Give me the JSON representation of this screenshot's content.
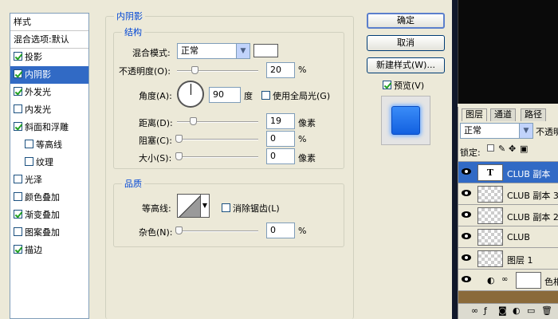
{
  "style_list": {
    "header": "样式",
    "items": [
      {
        "label": "混合选项:默认",
        "type": "plain"
      },
      {
        "label": "投影",
        "checked": true
      },
      {
        "label": "内阴影",
        "checked": true,
        "selected": true
      },
      {
        "label": "外发光",
        "checked": true
      },
      {
        "label": "内发光",
        "checked": false
      },
      {
        "label": "斜面和浮雕",
        "checked": true
      },
      {
        "label": "等高线",
        "checked": false,
        "sub": true
      },
      {
        "label": "纹理",
        "checked": false,
        "sub": true
      },
      {
        "label": "光泽",
        "checked": false
      },
      {
        "label": "颜色叠加",
        "checked": false
      },
      {
        "label": "渐变叠加",
        "checked": true
      },
      {
        "label": "图案叠加",
        "checked": false
      },
      {
        "label": "描边",
        "checked": true
      }
    ]
  },
  "inner_shadow": {
    "title": "内阴影",
    "structure": {
      "title": "结构",
      "blend_mode_label": "混合模式:",
      "blend_mode_value": "正常",
      "blend_color": "#ffffff",
      "opacity_label": "不透明度(O):",
      "opacity_value": "20",
      "opacity_unit": "%",
      "angle_label": "角度(A):",
      "angle_value": "90",
      "angle_unit": "度",
      "global_light_label": "使用全局光(G)",
      "global_light_checked": false,
      "distance_label": "距离(D):",
      "distance_value": "19",
      "distance_unit": "像素",
      "choke_label": "阻塞(C):",
      "choke_value": "0",
      "choke_unit": "%",
      "size_label": "大小(S):",
      "size_value": "0",
      "size_unit": "像素"
    },
    "quality": {
      "title": "品质",
      "contour_label": "等高线:",
      "antialias_label": "消除锯齿(L)",
      "antialias_checked": false,
      "noise_label": "杂色(N):",
      "noise_value": "0",
      "noise_unit": "%"
    }
  },
  "buttons": {
    "ok": "确定",
    "cancel": "取消",
    "new_style": "新建样式(W)...",
    "preview_label": "预览(V)",
    "preview_checked": true
  },
  "layers_panel": {
    "tabs": [
      "图层",
      "通道",
      "路径"
    ],
    "blend_mode": "正常",
    "opacity_label": "不透明",
    "lock_label": "锁定:",
    "layers": [
      {
        "name": "CLUB 副本",
        "thumb": "text",
        "thumb_text": "T",
        "selected": true
      },
      {
        "name": "CLUB 副本 3",
        "thumb": "checker"
      },
      {
        "name": "CLUB 副本 2",
        "thumb": "checker"
      },
      {
        "name": "CLUB",
        "thumb": "checker"
      },
      {
        "name": "图层 1",
        "thumb": "checker"
      },
      {
        "name": "色相",
        "thumb": "plain"
      }
    ]
  },
  "colors": {
    "selection": "#316ac5",
    "accent_title": "#0046d5",
    "preview_fill": "#2a7cf0"
  }
}
